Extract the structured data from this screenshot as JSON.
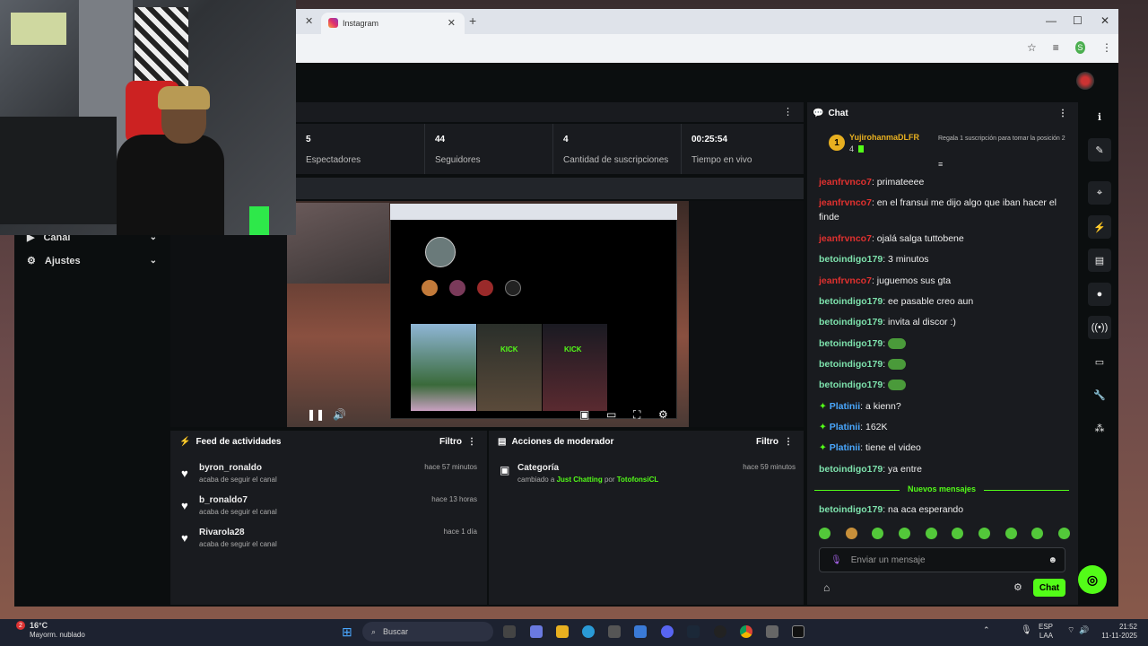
{
  "browser": {
    "tab_title": "Instagram",
    "tab_close": "✕",
    "new_tab": "+",
    "profile_letter": "S",
    "window_controls": [
      "—",
      "☐",
      "✕"
    ]
  },
  "sidebar": {
    "items": [
      {
        "label": "Canal",
        "icon": "video-icon"
      },
      {
        "label": "Ajustes",
        "icon": "gear-icon"
      }
    ]
  },
  "stats": [
    {
      "value": "5",
      "label": "Espectadores"
    },
    {
      "value": "44",
      "label": "Seguidores"
    },
    {
      "value": "4",
      "label": "Cantidad de suscripciones"
    },
    {
      "value": "00:25:54",
      "label": "Tiempo en vivo"
    }
  ],
  "feed": {
    "title": "Feed de actividades",
    "filter": "Filtro",
    "items": [
      {
        "name": "byron_ronaldo",
        "sub": "acaba de seguir el canal",
        "time": "hace 57 minutos"
      },
      {
        "name": "b_ronaldo7",
        "sub": "acaba de seguir el canal",
        "time": "hace 13 horas"
      },
      {
        "name": "Rivarola28",
        "sub": "acaba de seguir el canal",
        "time": "hace 1 día"
      }
    ]
  },
  "moderator": {
    "title": "Acciones de moderador",
    "filter": "Filtro",
    "item_title": "Categoría",
    "item_prefix": "cambiado a",
    "item_category": "Just Chatting",
    "item_by": "por",
    "item_user": "TotofonsiCL",
    "item_time": "hace 59 minutos"
  },
  "video_overlay": {
    "kick_label": "KICK"
  },
  "chat": {
    "title": "Chat",
    "pinned_user": "YujirohanmaDLFR",
    "pinned_count": "4",
    "pinned_rank": "1",
    "pinned_text": "Regala 1 suscripción para tomar la posición 2",
    "messages": [
      {
        "user": "jeanfrvnco7",
        "color": "red",
        "text": "primateeee"
      },
      {
        "user": "jeanfrvnco7",
        "color": "red",
        "text": "en el fransui me dijo algo que iban hacer el finde"
      },
      {
        "user": "jeanfrvnco7",
        "color": "red",
        "text": "ojalá salga tuttobene"
      },
      {
        "user": "betoindigo179",
        "color": "teal",
        "text": "3 minutos"
      },
      {
        "user": "jeanfrvnco7",
        "color": "red",
        "text": "juguemos sus gta"
      },
      {
        "user": "betoindigo179",
        "color": "teal",
        "text": "ee pasable creo aun"
      },
      {
        "user": "betoindigo179",
        "color": "teal",
        "text": "invita al discor :)"
      },
      {
        "user": "betoindigo179",
        "color": "teal",
        "text": ""
      },
      {
        "user": "betoindigo179",
        "color": "teal",
        "text": ""
      },
      {
        "user": "betoindigo179",
        "color": "teal",
        "text": ""
      },
      {
        "user": "Platinii",
        "color": "blue",
        "text": "a kienn?"
      },
      {
        "user": "Platinii",
        "color": "blue",
        "text": "162K"
      },
      {
        "user": "Platinii",
        "color": "blue",
        "text": "tiene el video"
      },
      {
        "user": "betoindigo179",
        "color": "teal",
        "text": "ya entre"
      }
    ],
    "new_messages_label": "Nuevos mensajes",
    "last_message": {
      "user": "betoindigo179",
      "text": "na aca esperando"
    },
    "input_placeholder": "Enviar un mensaje",
    "send_label": "Chat"
  },
  "taskbar": {
    "temp": "16°C",
    "weather": "Mayorm. nublado",
    "badge": "2",
    "search": "Buscar",
    "lang_1": "ESP",
    "lang_2": "LAA",
    "time": "21:52",
    "date": "11-11-2025"
  },
  "colors": {
    "accent": "#53fc18",
    "panel": "#191b1f",
    "bg": "#0b0e0f"
  }
}
